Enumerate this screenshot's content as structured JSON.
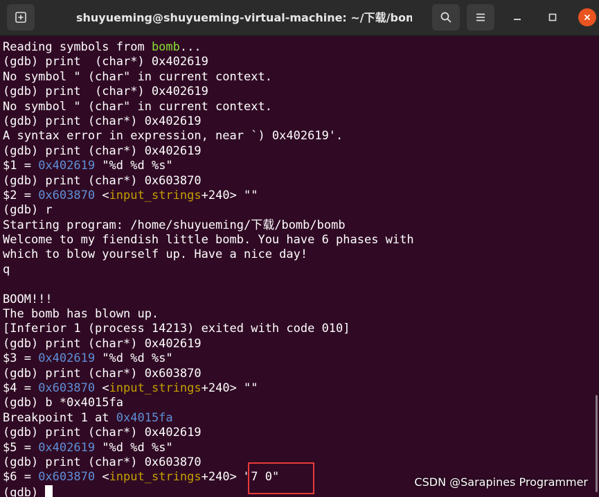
{
  "window": {
    "title": "shuyueming@shuyueming-virtual-machine: ~/下载/bomb",
    "new_tab_icon": "new-tab-icon",
    "search_icon": "search-icon",
    "menu_icon": "hamburger-menu-icon",
    "minimize_icon": "minimize-icon",
    "maximize_icon": "maximize-icon",
    "close_icon": "close-icon"
  },
  "colors": {
    "terminal_bg": "#300a24",
    "titlebar_bg": "#2b2b2b",
    "text": "#ffffff",
    "green": "#8ae234",
    "blue": "#5f8fd7",
    "yellow": "#c4a000",
    "close_button": "#e95420",
    "highlight_box": "#e83a3a"
  },
  "terminal": {
    "lines": [
      [
        {
          "t": "Reading symbols from "
        },
        {
          "t": "bomb",
          "c": "green"
        },
        {
          "t": "..."
        }
      ],
      [
        {
          "t": "(gdb) print  (char*) 0x402619"
        }
      ],
      [
        {
          "t": "No symbol \" (char\" in current context."
        }
      ],
      [
        {
          "t": "(gdb) print  (char*) 0x402619"
        }
      ],
      [
        {
          "t": "No symbol \" (char\" in current context."
        }
      ],
      [
        {
          "t": "(gdb) print (char*) 0x402619"
        }
      ],
      [
        {
          "t": "A syntax error in expression, near `) 0x402619'."
        }
      ],
      [
        {
          "t": "(gdb) print (char*) 0x402619"
        }
      ],
      [
        {
          "t": "$1 = "
        },
        {
          "t": "0x402619",
          "c": "blue"
        },
        {
          "t": " \"%d %d %s\""
        }
      ],
      [
        {
          "t": "(gdb) print (char*) 0x603870"
        }
      ],
      [
        {
          "t": "$2 = "
        },
        {
          "t": "0x603870",
          "c": "blue"
        },
        {
          "t": " <"
        },
        {
          "t": "input_strings",
          "c": "yellow"
        },
        {
          "t": "+240> \"\""
        }
      ],
      [
        {
          "t": "(gdb) r"
        }
      ],
      [
        {
          "t": "Starting program: /home/shuyueming/下载/bomb/bomb"
        }
      ],
      [
        {
          "t": "Welcome to my fiendish little bomb. You have 6 phases with"
        }
      ],
      [
        {
          "t": "which to blow yourself up. Have a nice day!"
        }
      ],
      [
        {
          "t": "q"
        }
      ],
      [
        {
          "t": ""
        }
      ],
      [
        {
          "t": "BOOM!!!"
        }
      ],
      [
        {
          "t": "The bomb has blown up."
        }
      ],
      [
        {
          "t": "[Inferior 1 (process 14213) exited with code 010]"
        }
      ],
      [
        {
          "t": "(gdb) print (char*) 0x402619"
        }
      ],
      [
        {
          "t": "$3 = "
        },
        {
          "t": "0x402619",
          "c": "blue"
        },
        {
          "t": " \"%d %d %s\""
        }
      ],
      [
        {
          "t": "(gdb) print (char*) 0x603870"
        }
      ],
      [
        {
          "t": "$4 = "
        },
        {
          "t": "0x603870",
          "c": "blue"
        },
        {
          "t": " <"
        },
        {
          "t": "input_strings",
          "c": "yellow"
        },
        {
          "t": "+240> \"\""
        }
      ],
      [
        {
          "t": "(gdb) b *0x4015fa"
        }
      ],
      [
        {
          "t": "Breakpoint 1 at "
        },
        {
          "t": "0x4015fa",
          "c": "blue"
        }
      ],
      [
        {
          "t": "(gdb) print (char*) 0x402619"
        }
      ],
      [
        {
          "t": "$5 = "
        },
        {
          "t": "0x402619",
          "c": "blue"
        },
        {
          "t": " \"%d %d %s\""
        }
      ],
      [
        {
          "t": "(gdb) print (char*) 0x603870"
        }
      ],
      [
        {
          "t": "$6 = "
        },
        {
          "t": "0x603870",
          "c": "blue"
        },
        {
          "t": " <"
        },
        {
          "t": "input_strings",
          "c": "yellow"
        },
        {
          "t": "+240> \"7 0\""
        }
      ],
      [
        {
          "t": "(gdb) "
        }
      ]
    ]
  },
  "watermark": "CSDN @Sarapines Programmer"
}
